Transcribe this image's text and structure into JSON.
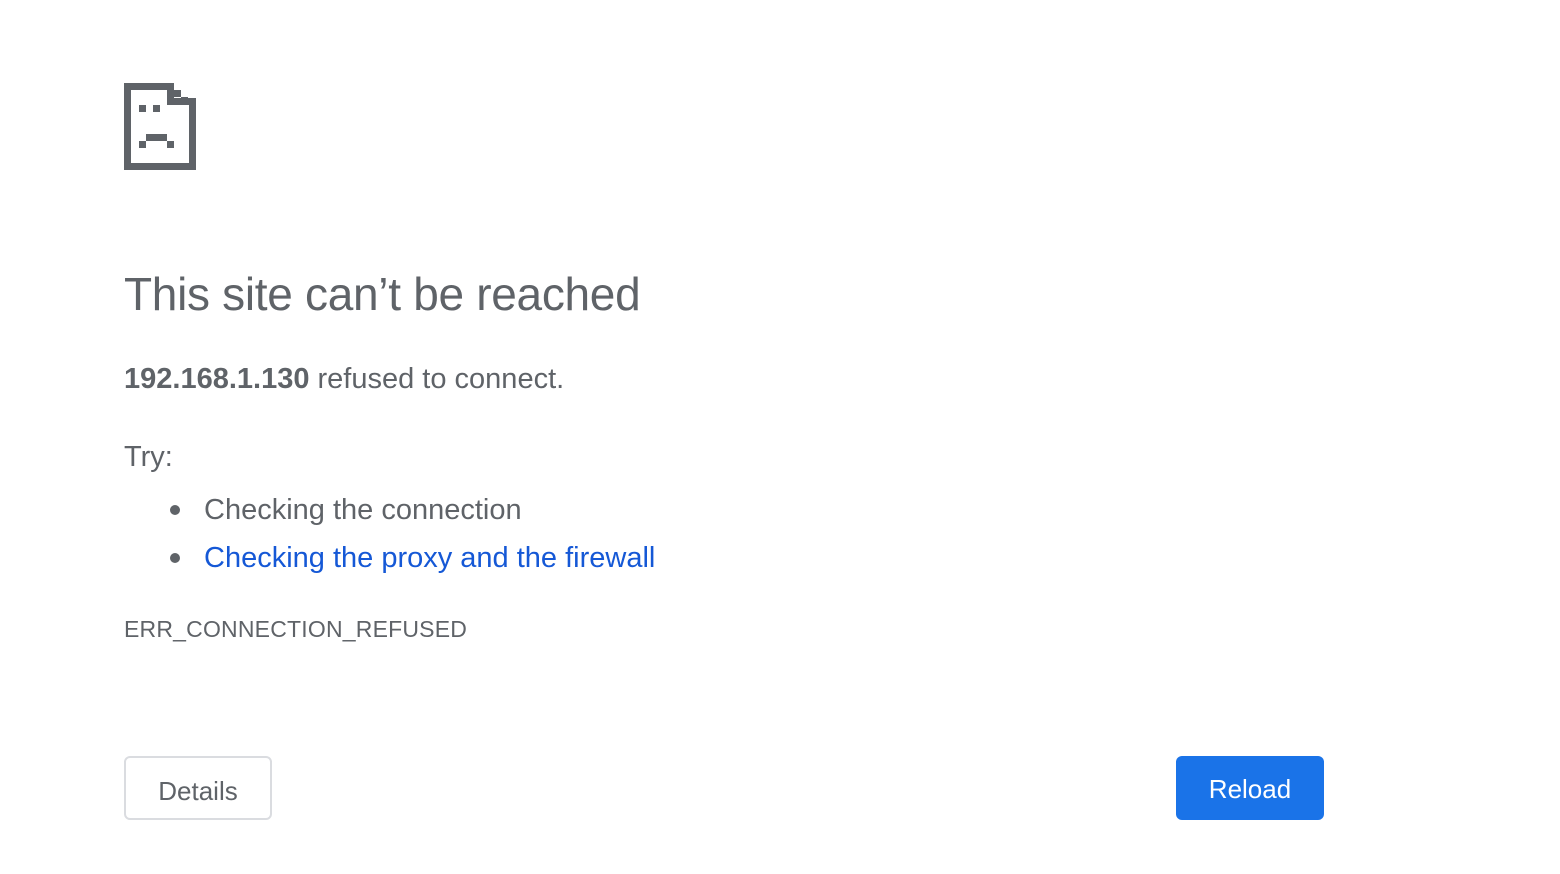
{
  "error_page": {
    "icon": "sad-page-icon",
    "heading": "This site can’t be reached",
    "summary": {
      "host": "192.168.1.130",
      "message": " refused to connect."
    },
    "try_label": "Try:",
    "suggestions": [
      {
        "text": "Checking the connection",
        "is_link": false
      },
      {
        "text": "Checking the proxy and the firewall",
        "is_link": true
      }
    ],
    "error_code": "ERR_CONNECTION_REFUSED",
    "buttons": {
      "details_label": "Details",
      "reload_label": "Reload"
    }
  },
  "colors": {
    "text": "#5f6368",
    "link": "#1558d6",
    "primary_button": "#1a73e8",
    "secondary_border": "#dadce0"
  }
}
